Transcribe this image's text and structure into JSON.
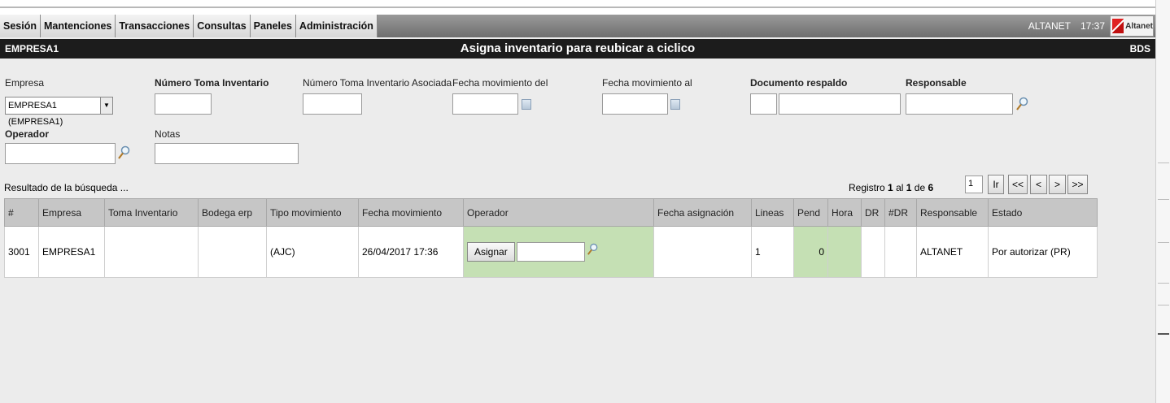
{
  "menu": {
    "items": [
      "Sesión",
      "Mantenciones",
      "Transacciones",
      "Consultas",
      "Paneles",
      "Administración"
    ],
    "user": "ALTANET",
    "time": "17:37",
    "logo_text": "Altanet"
  },
  "titlebar": {
    "company": "EMPRESA1",
    "title": "Asigna inventario para reubicar a ciclico",
    "code": "BDS"
  },
  "form": {
    "empresa_label": "Empresa",
    "empresa_value": "EMPRESA1 (EMPRESA1)",
    "numero_toma_label": "Número Toma Inventario",
    "numero_toma_asociada_label": "Número Toma Inventario Asociada",
    "fecha_del_label": "Fecha movimiento del",
    "fecha_al_label": "Fecha movimiento al",
    "documento_label": "Documento respaldo",
    "responsable_label": "Responsable",
    "operador_label": "Operador",
    "notas_label": "Notas"
  },
  "results": {
    "label": "Resultado de la búsqueda ...",
    "registro_prefix": "Registro",
    "registro_from": "1",
    "registro_al": "al",
    "registro_to": "1",
    "registro_de": "de",
    "registro_total": "6",
    "page_input": "1",
    "go_label": "Ir",
    "first_label": "<<",
    "prev_label": "<",
    "next_label": ">",
    "last_label": ">>"
  },
  "table": {
    "headers": [
      "#",
      "Empresa",
      "Toma Inventario",
      "Bodega erp",
      "Tipo movimiento",
      "Fecha movimiento",
      "Operador",
      "Fecha asignación",
      "Lineas",
      "Pend",
      "Hora",
      "DR",
      "#DR",
      "Responsable",
      "Estado"
    ],
    "rows": [
      {
        "num": "3001",
        "empresa": "EMPRESA1",
        "toma": "",
        "bodega": "",
        "tipo": "(AJC)",
        "fecha": "26/04/2017 17:36",
        "asignar_label": "Asignar",
        "fecha_asignacion": "",
        "lineas": "1",
        "pend": "0",
        "hora": "",
        "dr": "",
        "ndr": "",
        "responsable": "ALTANET",
        "estado": "Por autorizar (PR)"
      }
    ]
  },
  "colors": {
    "menu_bg": "#7a7a7a",
    "titlebar_bg": "#1c1c1c",
    "panel_bg": "#ececec",
    "highlight_green": "#c5e0b4",
    "header_gray": "#c6c6c6"
  }
}
